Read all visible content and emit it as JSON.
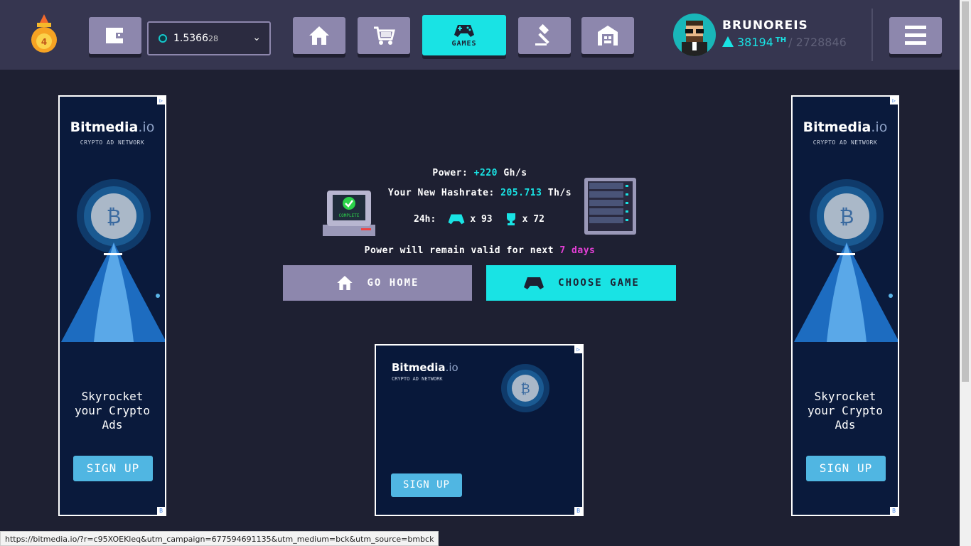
{
  "header": {
    "balance": {
      "main": "1.5366",
      "small": "28"
    },
    "games_label": "GAMES",
    "username": "BRUNOREIS",
    "hashrate": "38194",
    "hashrate_unit": "TH",
    "hashrate_total": "/ 2728846",
    "icons": [
      "wallet-icon",
      "home-icon",
      "cart-icon",
      "gamepad-icon",
      "auction-icon",
      "storage-icon",
      "menu-icon"
    ]
  },
  "result": {
    "power_label": "Power:",
    "power_value": "+220",
    "power_unit": "Gh/s",
    "hashrate_label": "Your New Hashrate:",
    "hashrate_value": "205.713",
    "hashrate_unit": "Th/s",
    "period": "24h:",
    "games_count": "x 93",
    "trophies_count": "x 72",
    "validity_text": "Power will remain valid for next",
    "validity_value": "7 days",
    "complete_label": "COMPLETE"
  },
  "actions": {
    "go_home": "GO HOME",
    "choose_game": "CHOOSE GAME"
  },
  "ads": {
    "brand": "Bitmedia",
    "brand_suffix": ".io",
    "subtitle": "CRYPTO AD NETWORK",
    "copy": [
      "Skyrocket",
      "your Crypto",
      "Ads"
    ],
    "cta": "SIGN UP"
  },
  "status_url": "https://bitmedia.io/?r=c95XOEKleq&utm_campaign=677594691135&utm_medium=bck&utm_source=bmbck",
  "colors": {
    "accent": "#19e3e4",
    "button": "#8d87ad",
    "bg": "#1e2032",
    "header": "#363650",
    "highlight": "#e43fd6"
  }
}
